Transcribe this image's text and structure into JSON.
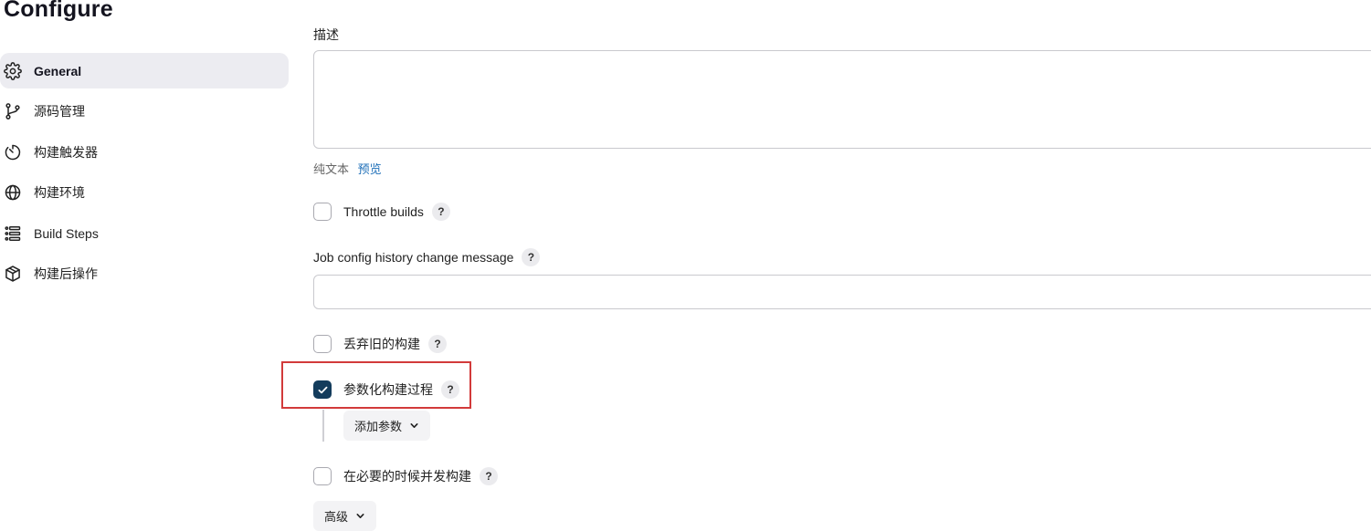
{
  "page": {
    "title": "Configure"
  },
  "sidebar": {
    "items": [
      {
        "label": "General",
        "icon": "gear-icon",
        "active": true
      },
      {
        "label": "源码管理",
        "icon": "git-branch-icon",
        "active": false
      },
      {
        "label": "构建触发器",
        "icon": "timer-icon",
        "active": false
      },
      {
        "label": "构建环境",
        "icon": "globe-icon",
        "active": false
      },
      {
        "label": "Build Steps",
        "icon": "list-icon",
        "active": false
      },
      {
        "label": "构建后操作",
        "icon": "package-icon",
        "active": false
      }
    ]
  },
  "form": {
    "description": {
      "label": "描述",
      "value": ""
    },
    "format": {
      "plain_text": "纯文本",
      "preview_link": "预览"
    },
    "throttle_builds": {
      "label": "Throttle builds",
      "checked": false,
      "help": "?"
    },
    "job_config_message": {
      "label": "Job config history change message",
      "value": "",
      "help": "?"
    },
    "discard_old_builds": {
      "label": "丢弃旧的构建",
      "checked": false,
      "help": "?"
    },
    "parameterized": {
      "label": "参数化构建过程",
      "checked": true,
      "help": "?"
    },
    "add_parameter": {
      "label": "添加参数"
    },
    "concurrent_builds": {
      "label": "在必要的时候并发构建",
      "checked": false,
      "help": "?"
    },
    "advanced": {
      "label": "高级"
    }
  },
  "colors": {
    "accent": "#133c5c",
    "link": "#1e6fb8",
    "highlight": "#d23a3a",
    "active_bg": "#ececf1"
  }
}
